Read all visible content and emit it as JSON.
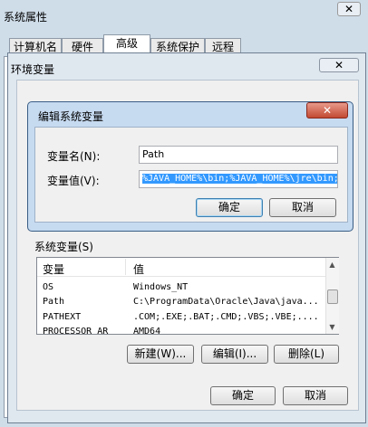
{
  "system_properties": {
    "title": "系统属性",
    "close_label": "✕",
    "tabs": [
      "计算机名",
      "硬件",
      "高级",
      "系统保护",
      "远程"
    ],
    "active_tab_index": 2
  },
  "env_dialog": {
    "title": "环境变量",
    "close_label": "✕",
    "system_vars_label": "系统变量(S)",
    "columns": [
      "变量",
      "值"
    ],
    "rows": [
      {
        "name": "OS",
        "value": "Windows_NT"
      },
      {
        "name": "Path",
        "value": "C:\\ProgramData\\Oracle\\Java\\java..."
      },
      {
        "name": "PATHEXT",
        "value": ".COM;.EXE;.BAT;.CMD;.VBS;.VBE;...."
      },
      {
        "name": "PROCESSOR_AR",
        "value": "AMD64"
      }
    ],
    "new_button": "新建(W)...",
    "edit_button": "编辑(I)...",
    "delete_button": "删除(L)",
    "ok_button": "确定",
    "cancel_button": "取消"
  },
  "edit_dialog": {
    "title": "编辑系统变量",
    "close_label": "✕",
    "var_name_label": "变量名(N):",
    "var_name_value": "Path",
    "var_value_label": "变量值(V):",
    "var_value_value": "%JAVA_HOME%\\bin;%JAVA_HOME%\\jre\\bin;",
    "ok_button": "确定",
    "cancel_button": "取消"
  },
  "colors": {
    "selection": "#3399ff",
    "close_red": "#c24a32",
    "window_frame": "#c6daf0"
  }
}
